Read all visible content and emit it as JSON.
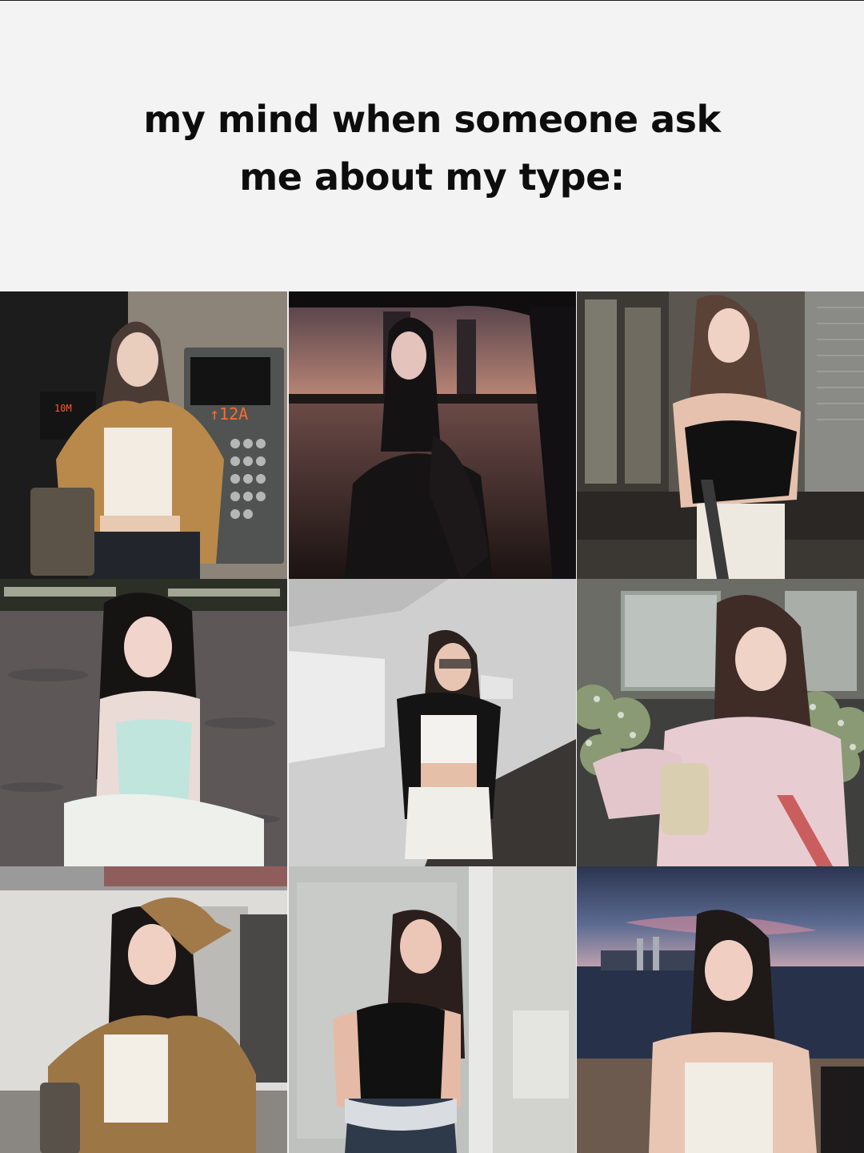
{
  "caption": {
    "line1": "my mind when someone ask",
    "line2": "me about my type:"
  },
  "photos": [
    {
      "scene": "elevator-lobby",
      "elevator_display": "↑12A",
      "side_display": "10M"
    },
    {
      "scene": "river-sunset"
    },
    {
      "scene": "cafe-terrace"
    },
    {
      "scene": "beach-night"
    },
    {
      "scene": "white-hallway"
    },
    {
      "scene": "cafe-flowers"
    },
    {
      "scene": "office-laughing"
    },
    {
      "scene": "glass-doorway"
    },
    {
      "scene": "beach-dusk"
    }
  ]
}
